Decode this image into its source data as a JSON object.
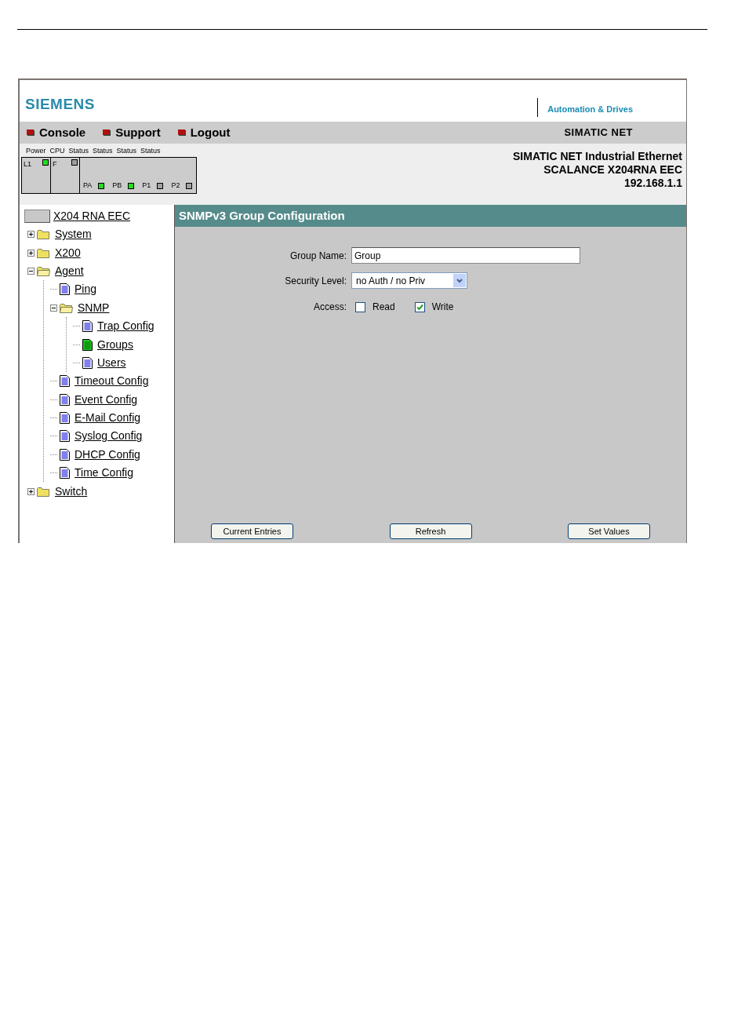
{
  "header": {
    "logo": "SIEMENS",
    "division": "Automation & Drives"
  },
  "nav": {
    "items": [
      {
        "label": "Console"
      },
      {
        "label": "Support"
      },
      {
        "label": "Logout"
      }
    ],
    "product": "SIMATIC NET"
  },
  "status_panel": {
    "headings": [
      "Power",
      "CPU",
      "Status",
      "Status",
      "Status",
      "Status"
    ],
    "power": {
      "label": "L1",
      "on": true
    },
    "cpu": {
      "label": "F",
      "on": false
    },
    "ports": [
      {
        "label": "PA",
        "on": true
      },
      {
        "label": "PB",
        "on": true
      },
      {
        "label": "P1",
        "on": false
      },
      {
        "label": "P2",
        "on": false
      }
    ]
  },
  "device_info": [
    "SIMATIC NET Industrial Ethernet",
    "SCALANCE X204RNA EEC",
    "192.168.1.1"
  ],
  "tree": {
    "root": "X204 RNA EEC",
    "items": [
      {
        "label": "System",
        "kind": "folder",
        "expanded": false,
        "selected": false
      },
      {
        "label": "X200",
        "kind": "folder",
        "expanded": false,
        "selected": false
      },
      {
        "label": "Agent",
        "kind": "folder",
        "expanded": true,
        "selected": false,
        "children": [
          {
            "label": "Ping",
            "kind": "page",
            "selected": false
          },
          {
            "label": "SNMP",
            "kind": "folder",
            "expanded": true,
            "selected": false,
            "children": [
              {
                "label": "Trap Config",
                "kind": "page",
                "selected": false
              },
              {
                "label": "Groups",
                "kind": "page",
                "selected": true
              },
              {
                "label": "Users",
                "kind": "page",
                "selected": false
              }
            ]
          },
          {
            "label": "Timeout Config",
            "kind": "page",
            "selected": false
          },
          {
            "label": "Event Config",
            "kind": "page",
            "selected": false
          },
          {
            "label": "E-Mail Config",
            "kind": "page",
            "selected": false
          },
          {
            "label": "Syslog Config",
            "kind": "page",
            "selected": false
          },
          {
            "label": "DHCP Config",
            "kind": "page",
            "selected": false
          },
          {
            "label": "Time Config",
            "kind": "page",
            "selected": false
          }
        ]
      },
      {
        "label": "Switch",
        "kind": "folder",
        "expanded": false,
        "selected": false
      }
    ]
  },
  "content": {
    "title": "SNMPv3 Group Configuration",
    "group_name": {
      "label": "Group Name:",
      "value": "Group"
    },
    "security_level": {
      "label": "Security Level:",
      "value": "no Auth / no Priv"
    },
    "access": {
      "label": "Access:",
      "options": [
        {
          "label": "Read",
          "checked": false
        },
        {
          "label": "Write",
          "checked": true
        }
      ]
    },
    "buttons": [
      "Current Entries",
      "Refresh",
      "Set Values"
    ]
  }
}
